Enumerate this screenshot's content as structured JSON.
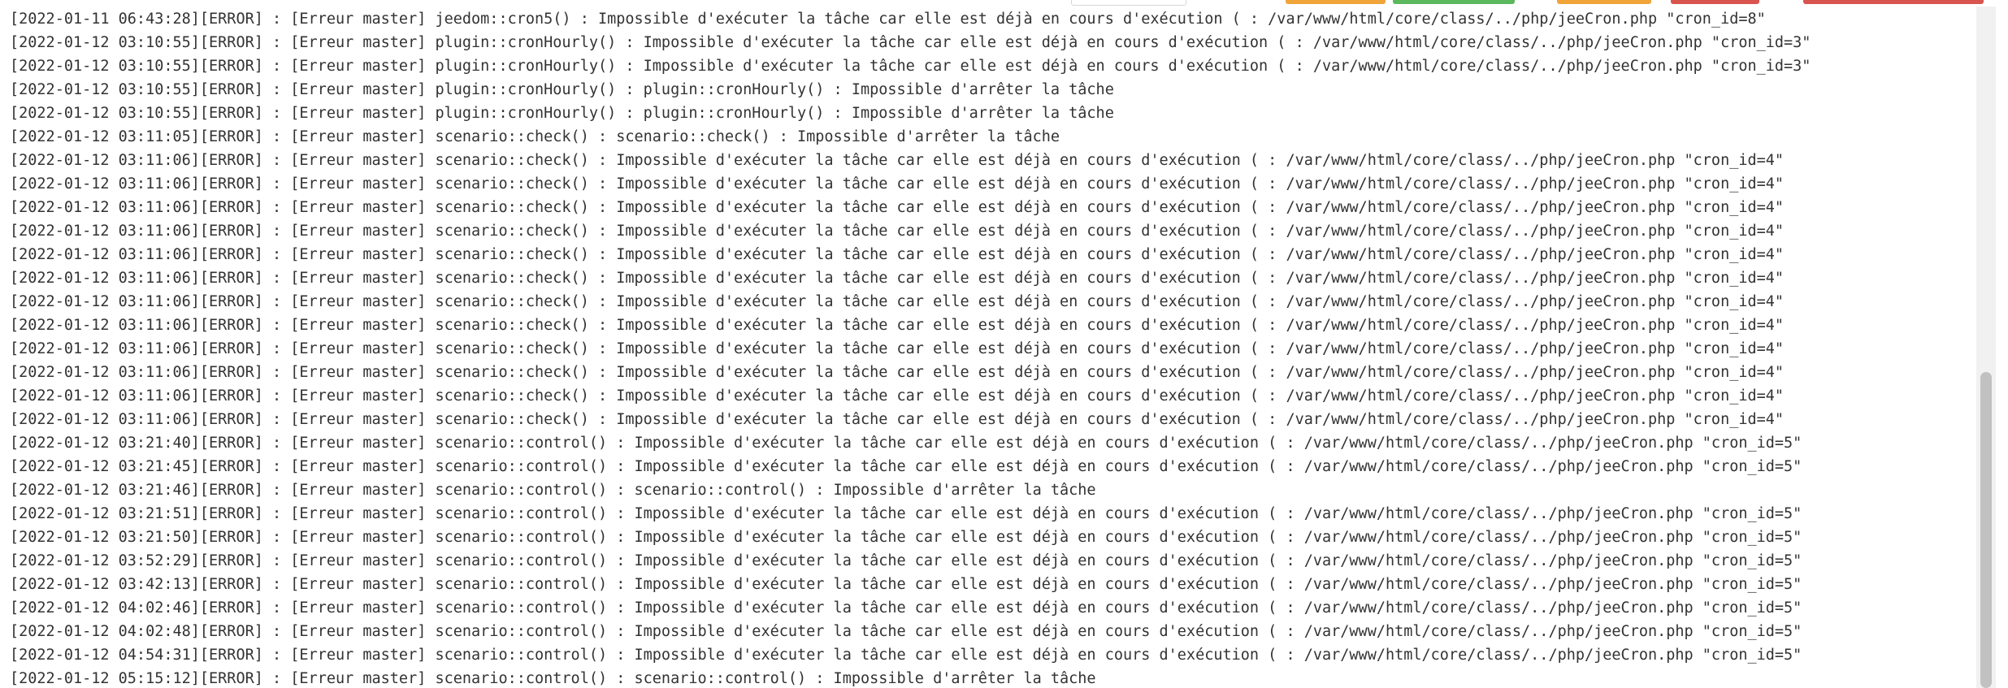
{
  "log": {
    "lines": [
      "[2022-01-11 06:43:28][ERROR] : [Erreur master] jeedom::cron5() : Impossible d'exécuter la tâche car elle est déjà en cours d'exécution ( : /var/www/html/core/class/../php/jeeCron.php \"cron_id=8\"",
      "[2022-01-12 03:10:55][ERROR] : [Erreur master] plugin::cronHourly() : Impossible d'exécuter la tâche car elle est déjà en cours d'exécution ( : /var/www/html/core/class/../php/jeeCron.php \"cron_id=3\"",
      "[2022-01-12 03:10:55][ERROR] : [Erreur master] plugin::cronHourly() : Impossible d'exécuter la tâche car elle est déjà en cours d'exécution ( : /var/www/html/core/class/../php/jeeCron.php \"cron_id=3\"",
      "[2022-01-12 03:10:55][ERROR] : [Erreur master] plugin::cronHourly() : plugin::cronHourly() : Impossible d'arrêter la tâche",
      "[2022-01-12 03:10:55][ERROR] : [Erreur master] plugin::cronHourly() : plugin::cronHourly() : Impossible d'arrêter la tâche",
      "[2022-01-12 03:11:05][ERROR] : [Erreur master] scenario::check() : scenario::check() : Impossible d'arrêter la tâche",
      "[2022-01-12 03:11:06][ERROR] : [Erreur master] scenario::check() : Impossible d'exécuter la tâche car elle est déjà en cours d'exécution ( : /var/www/html/core/class/../php/jeeCron.php \"cron_id=4\"",
      "[2022-01-12 03:11:06][ERROR] : [Erreur master] scenario::check() : Impossible d'exécuter la tâche car elle est déjà en cours d'exécution ( : /var/www/html/core/class/../php/jeeCron.php \"cron_id=4\"",
      "[2022-01-12 03:11:06][ERROR] : [Erreur master] scenario::check() : Impossible d'exécuter la tâche car elle est déjà en cours d'exécution ( : /var/www/html/core/class/../php/jeeCron.php \"cron_id=4\"",
      "[2022-01-12 03:11:06][ERROR] : [Erreur master] scenario::check() : Impossible d'exécuter la tâche car elle est déjà en cours d'exécution ( : /var/www/html/core/class/../php/jeeCron.php \"cron_id=4\"",
      "[2022-01-12 03:11:06][ERROR] : [Erreur master] scenario::check() : Impossible d'exécuter la tâche car elle est déjà en cours d'exécution ( : /var/www/html/core/class/../php/jeeCron.php \"cron_id=4\"",
      "[2022-01-12 03:11:06][ERROR] : [Erreur master] scenario::check() : Impossible d'exécuter la tâche car elle est déjà en cours d'exécution ( : /var/www/html/core/class/../php/jeeCron.php \"cron_id=4\"",
      "[2022-01-12 03:11:06][ERROR] : [Erreur master] scenario::check() : Impossible d'exécuter la tâche car elle est déjà en cours d'exécution ( : /var/www/html/core/class/../php/jeeCron.php \"cron_id=4\"",
      "[2022-01-12 03:11:06][ERROR] : [Erreur master] scenario::check() : Impossible d'exécuter la tâche car elle est déjà en cours d'exécution ( : /var/www/html/core/class/../php/jeeCron.php \"cron_id=4\"",
      "[2022-01-12 03:11:06][ERROR] : [Erreur master] scenario::check() : Impossible d'exécuter la tâche car elle est déjà en cours d'exécution ( : /var/www/html/core/class/../php/jeeCron.php \"cron_id=4\"",
      "[2022-01-12 03:11:06][ERROR] : [Erreur master] scenario::check() : Impossible d'exécuter la tâche car elle est déjà en cours d'exécution ( : /var/www/html/core/class/../php/jeeCron.php \"cron_id=4\"",
      "[2022-01-12 03:11:06][ERROR] : [Erreur master] scenario::check() : Impossible d'exécuter la tâche car elle est déjà en cours d'exécution ( : /var/www/html/core/class/../php/jeeCron.php \"cron_id=4\"",
      "[2022-01-12 03:11:06][ERROR] : [Erreur master] scenario::check() : Impossible d'exécuter la tâche car elle est déjà en cours d'exécution ( : /var/www/html/core/class/../php/jeeCron.php \"cron_id=4\"",
      "[2022-01-12 03:21:40][ERROR] : [Erreur master] scenario::control() : Impossible d'exécuter la tâche car elle est déjà en cours d'exécution ( : /var/www/html/core/class/../php/jeeCron.php \"cron_id=5\"",
      "[2022-01-12 03:21:45][ERROR] : [Erreur master] scenario::control() : Impossible d'exécuter la tâche car elle est déjà en cours d'exécution ( : /var/www/html/core/class/../php/jeeCron.php \"cron_id=5\"",
      "[2022-01-12 03:21:46][ERROR] : [Erreur master] scenario::control() : scenario::control() : Impossible d'arrêter la tâche",
      "[2022-01-12 03:21:51][ERROR] : [Erreur master] scenario::control() : Impossible d'exécuter la tâche car elle est déjà en cours d'exécution ( : /var/www/html/core/class/../php/jeeCron.php \"cron_id=5\"",
      "[2022-01-12 03:21:50][ERROR] : [Erreur master] scenario::control() : Impossible d'exécuter la tâche car elle est déjà en cours d'exécution ( : /var/www/html/core/class/../php/jeeCron.php \"cron_id=5\"",
      "[2022-01-12 03:52:29][ERROR] : [Erreur master] scenario::control() : Impossible d'exécuter la tâche car elle est déjà en cours d'exécution ( : /var/www/html/core/class/../php/jeeCron.php \"cron_id=5\"",
      "[2022-01-12 03:42:13][ERROR] : [Erreur master] scenario::control() : Impossible d'exécuter la tâche car elle est déjà en cours d'exécution ( : /var/www/html/core/class/../php/jeeCron.php \"cron_id=5\"",
      "[2022-01-12 04:02:46][ERROR] : [Erreur master] scenario::control() : Impossible d'exécuter la tâche car elle est déjà en cours d'exécution ( : /var/www/html/core/class/../php/jeeCron.php \"cron_id=5\"",
      "[2022-01-12 04:02:48][ERROR] : [Erreur master] scenario::control() : Impossible d'exécuter la tâche car elle est déjà en cours d'exécution ( : /var/www/html/core/class/../php/jeeCron.php \"cron_id=5\"",
      "[2022-01-12 04:54:31][ERROR] : [Erreur master] scenario::control() : Impossible d'exécuter la tâche car elle est déjà en cours d'exécution ( : /var/www/html/core/class/../php/jeeCron.php \"cron_id=5\"",
      "[2022-01-12 05:15:12][ERROR] : [Erreur master] scenario::control() : scenario::control() : Impossible d'arrêter la tâche"
    ]
  }
}
